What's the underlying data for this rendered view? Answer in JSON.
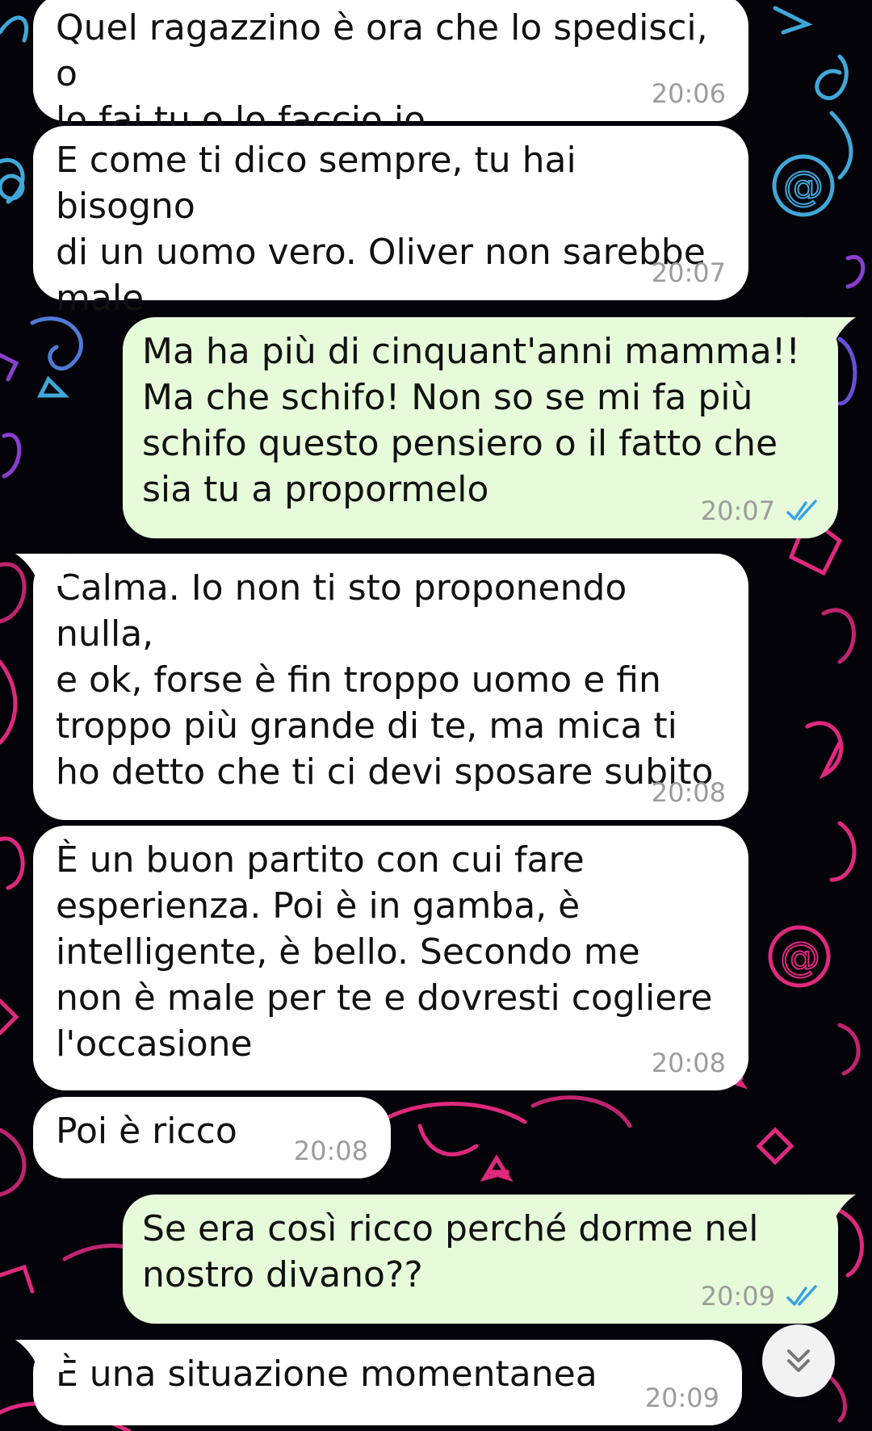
{
  "chat": {
    "messages": [
      {
        "direction": "incoming",
        "text": "Quel ragazzino è ora che lo spedisci, o\nlo fai tu o lo faccio io",
        "time": "20:06"
      },
      {
        "direction": "incoming",
        "text": "E come ti dico sempre, tu hai bisogno\ndi un uomo vero. Oliver non sarebbe\nmale",
        "time": "20:07"
      },
      {
        "direction": "outgoing",
        "text": "Ma ha più di cinquant'anni mamma!!\nMa che schifo! Non so se mi fa più\nschifo questo pensiero o il fatto che\nsia tu a propormelo",
        "time": "20:07",
        "status": "read"
      },
      {
        "direction": "incoming",
        "text": "Calma. Io non ti sto proponendo nulla,\ne ok, forse è fin troppo uomo e fin\ntroppo più grande di te, ma mica ti\nho detto che ti ci devi sposare subito",
        "time": "20:08"
      },
      {
        "direction": "incoming",
        "text": "È un buon partito con cui fare\nesperienza. Poi è in gamba, è\nintelligente, è bello. Secondo me\nnon è male per te e dovresti cogliere\nl'occasione",
        "time": "20:08"
      },
      {
        "direction": "incoming",
        "text": "Poi è ricco",
        "time": "20:08"
      },
      {
        "direction": "outgoing",
        "text": "Se era così ricco perché dorme nel\nnostro divano??",
        "time": "20:09",
        "status": "read"
      },
      {
        "direction": "incoming",
        "text": "È una situazione momentanea",
        "time": "20:09"
      }
    ]
  },
  "icons": {
    "read_receipt": "double-check-icon",
    "scroll_down": "double-chevron-down-icon"
  },
  "colors": {
    "incoming_bubble": "#ffffff",
    "outgoing_bubble": "#e6fbd9",
    "read_ticks": "#35a3e6",
    "timestamp": "#9c9c9c",
    "wallpaper_bg": "#05030a",
    "doodle_pink": "#e0287e",
    "doodle_blue": "#3fa8d8",
    "doodle_purple": "#8a3fd0"
  }
}
